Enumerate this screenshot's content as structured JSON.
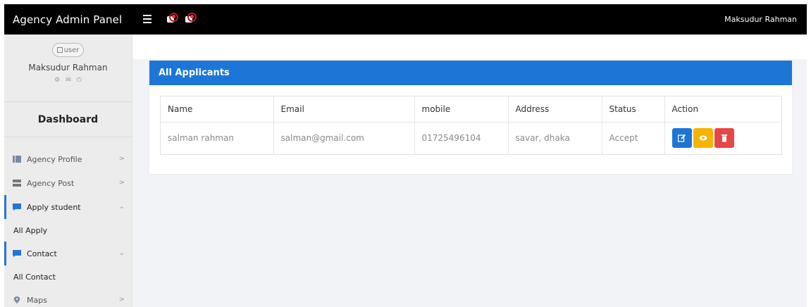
{
  "topbar": {
    "brand": "Agency Admin Panel",
    "user_name": "Maksudur Rahman"
  },
  "sidebar": {
    "avatar_alt": "user",
    "user_name": "Maksudur Rahman",
    "dashboard_label": "Dashboard",
    "items": [
      {
        "label": "Agency Profile"
      },
      {
        "label": "Agency Post"
      },
      {
        "label": "Apply student",
        "submenu": "All Apply"
      },
      {
        "label": "Contact",
        "submenu": "All Contact"
      },
      {
        "label": "Maps"
      }
    ]
  },
  "card": {
    "title": "All Applicants",
    "columns": [
      "Name",
      "Email",
      "mobile",
      "Address",
      "Status",
      "Action"
    ],
    "rows": [
      {
        "name": "salman rahman",
        "email": "salman@gmail.com",
        "mobile": "01725496104",
        "address": "savar, dhaka",
        "status": "Accept"
      }
    ]
  },
  "colors": {
    "topbar": "#000000",
    "accent_blue": "#1d76d6",
    "view_yellow": "#f5b400",
    "delete_red": "#e84646"
  },
  "icons": [
    "menu-icon",
    "flag-notification-icon",
    "mail-notification-icon",
    "gear-icon",
    "envelope-icon",
    "power-icon",
    "table-icon",
    "server-icon",
    "comment-icon",
    "map-marker-icon",
    "edit-icon",
    "eye-icon",
    "trash-icon"
  ]
}
